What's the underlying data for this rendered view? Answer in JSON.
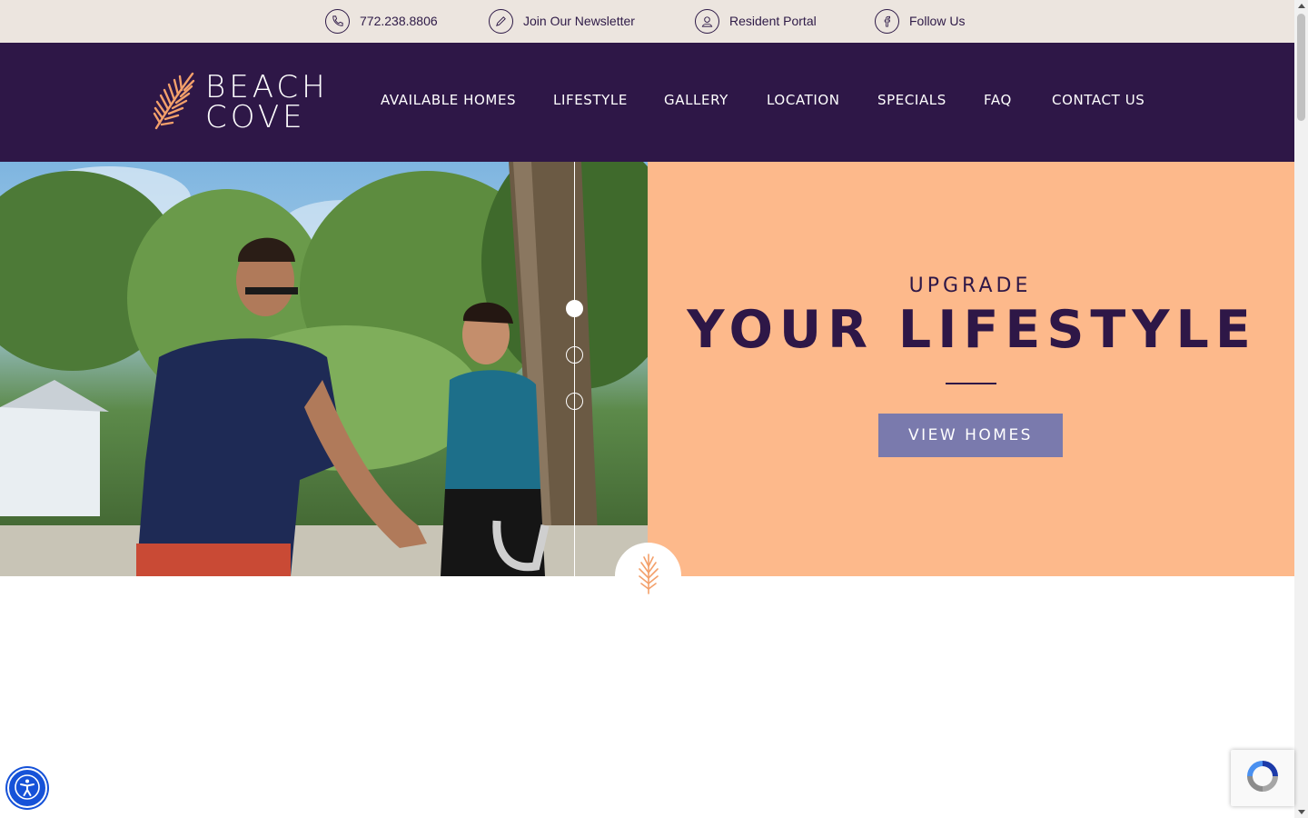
{
  "utility_bar": {
    "phone": "772.238.8806",
    "newsletter": "Join Our Newsletter",
    "resident_portal": "Resident Portal",
    "follow": "Follow Us"
  },
  "brand": {
    "line1": "BEACH",
    "line2": "COVE"
  },
  "nav": {
    "items": [
      "AVAILABLE HOMES",
      "LIFESTYLE",
      "GALLERY",
      "LOCATION",
      "SPECIALS",
      "FAQ",
      "CONTACT US"
    ]
  },
  "hero": {
    "eyebrow": "UPGRADE",
    "title": "YOUR LIFESTYLE",
    "button": "VIEW HOMES",
    "slides": [
      {
        "active": true
      },
      {
        "active": false
      },
      {
        "active": false
      }
    ]
  },
  "colors": {
    "header_bg": "#2e1747",
    "utility_bg": "#ece5df",
    "panel_bg": "#fdb98b",
    "button_bg": "#7a7aad",
    "accent": "#f3a06b"
  },
  "icons": {
    "phone": "phone-icon",
    "newsletter": "pen-icon",
    "portal": "user-icon",
    "facebook": "facebook-icon",
    "logo": "palm-leaf-icon",
    "accessibility": "accessibility-icon",
    "recaptcha": "recaptcha-icon"
  }
}
